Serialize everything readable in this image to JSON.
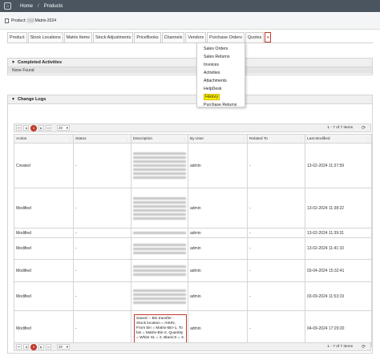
{
  "topbar": {
    "home": "Home",
    "separator": "/",
    "current": "Products"
  },
  "product": {
    "prefix": "Product:",
    "suffix": "Matrix-2024"
  },
  "tabs": [
    "Product",
    "Stock Locations",
    "Matrix Items",
    "Stock Adjustments",
    "PriceBooks",
    "Channels",
    "Vendors",
    "Purchase Orders",
    "Quotes"
  ],
  "tab_more": "▾",
  "dropdown": [
    "Sales Orders",
    "Sales Returns",
    "Invoices",
    "Activities",
    "Attachments",
    "HelpDesk",
    "History",
    "Purchase Returns"
  ],
  "completed": {
    "title": "Completed Activities",
    "empty": "None Found"
  },
  "changelogs": {
    "title": "Change Logs",
    "pager": {
      "page": "1",
      "page_size": "20",
      "info": "1 - 7 of 7 items",
      "first": "⏮",
      "prev": "◀",
      "next": "▶",
      "last": "⏭",
      "refresh": "⟳"
    },
    "columns": [
      "Action",
      "Status",
      "Description",
      "By User",
      "Related To",
      "Last Modified"
    ],
    "rows": [
      {
        "action": "Created",
        "status": "-",
        "user": "admin",
        "related": "-",
        "modified": "13-02-2024 11:37:59"
      },
      {
        "action": "Modified",
        "status": "-",
        "user": "admin",
        "related": "-",
        "modified": "13-02-2024 11:38:22"
      },
      {
        "action": "Modified",
        "status": "-",
        "user": "admin",
        "related": "-",
        "modified": "13-02-2024 11:39:31"
      },
      {
        "action": "Modified",
        "status": "-",
        "user": "admin",
        "related": "-",
        "modified": "13-02-2024 11:41:10"
      },
      {
        "action": "Modified",
        "status": "-",
        "user": "admin",
        "related": "-",
        "modified": "03-04-2024 15:32:41"
      },
      {
        "action": "Modified",
        "status": "-",
        "user": "admin",
        "related": "-",
        "modified": "03-09-2024 11:53:19"
      },
      {
        "action": "Modified",
        "status": "-",
        "user": "admin",
        "related": "-",
        "modified": "04-09-2024 17:29:20"
      }
    ],
    "last_description": "Saved -- Bin transfer - Stock location = AIKIN, From bin = Matrix-Bin-1, To bin = Matrix-Bin-2, Quantity = White XL = 2, Black:S = 3."
  }
}
